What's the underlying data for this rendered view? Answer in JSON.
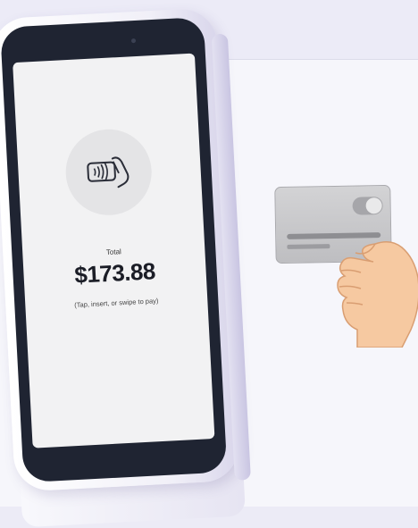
{
  "terminal": {
    "screen": {
      "icon": "contactless-tap-icon",
      "total_label": "Total",
      "amount": "$173.88",
      "hint": "(Tap, insert, or swipe to pay)"
    }
  },
  "illustration": {
    "card": "credit-card-icon",
    "hand": "hand-icon"
  },
  "colors": {
    "background": "#ECEBF6",
    "panel": "#F6F6FB",
    "bezel": "#1F2432",
    "screen": "#F2F2F3",
    "card": "#C9C9CC",
    "skin": "#F6C9A1"
  }
}
